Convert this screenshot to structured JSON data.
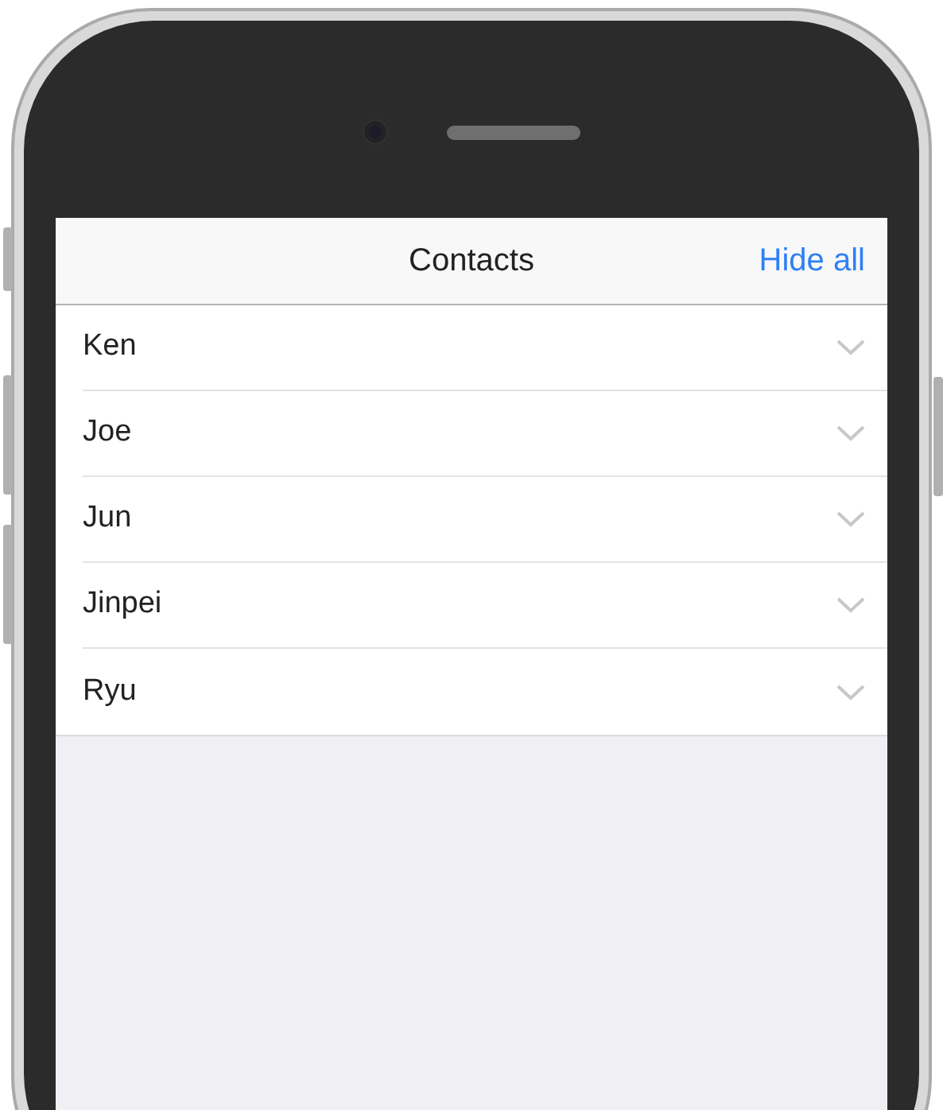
{
  "navigation_bar": {
    "title": "Contacts",
    "action": "Hide all"
  },
  "contacts": [
    {
      "name": "Ken",
      "expanded": false
    },
    {
      "name": "Joe",
      "expanded": false
    },
    {
      "name": "Jun",
      "expanded": false
    },
    {
      "name": "Jinpei",
      "expanded": false
    },
    {
      "name": "Ryu",
      "expanded": false
    }
  ]
}
